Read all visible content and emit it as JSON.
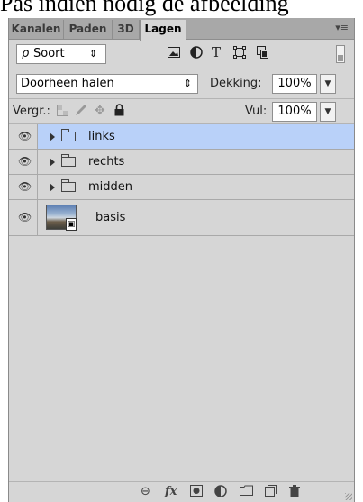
{
  "caption": "Pas indien nodig de afbeelding",
  "tabs": [
    {
      "label": "Kanalen",
      "active": false
    },
    {
      "label": "Paden",
      "active": false
    },
    {
      "label": "3D",
      "active": false
    },
    {
      "label": "Lagen",
      "active": true
    }
  ],
  "filter": {
    "search_symbol": "ρ",
    "kind_label": "Soort",
    "stepper_symbol": "⇕",
    "icons": [
      "image-filter-icon",
      "adjustment-filter-icon",
      "type-filter-icon",
      "shape-filter-icon",
      "smart-object-filter-icon"
    ]
  },
  "blend": {
    "mode": "Doorheen halen",
    "opacity_label": "Dekking:",
    "opacity_value": "100%"
  },
  "lock": {
    "label": "Vergr.:",
    "fill_label": "Vul:",
    "fill_value": "100%"
  },
  "layers": [
    {
      "name": "links",
      "type": "group",
      "selected": true
    },
    {
      "name": "rechts",
      "type": "group",
      "selected": false
    },
    {
      "name": "midden",
      "type": "group",
      "selected": false
    },
    {
      "name": "basis",
      "type": "smart-object",
      "selected": false
    }
  ],
  "bottom_icons": [
    "link-icon",
    "fx-icon",
    "mask-icon",
    "adjustment-icon",
    "folder-icon",
    "new-layer-icon",
    "trash-icon"
  ],
  "colors": {
    "panel_bg": "#d6d6d6",
    "tabbar_bg": "#a8a8a8",
    "selected_row": "#b9d1f9"
  }
}
